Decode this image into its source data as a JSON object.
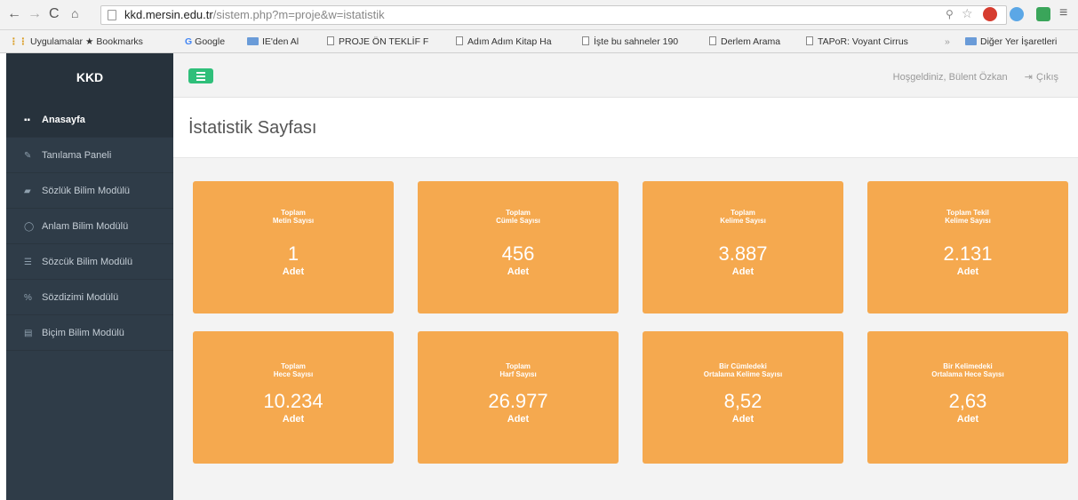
{
  "browser": {
    "url_host": "kkd.mersin.edu.tr",
    "url_path": "/sistem.php?m=proje&w=istatistik",
    "bookmarks": [
      {
        "label": "Uygulamalar",
        "type": "apps"
      },
      {
        "label": "Bookmarks",
        "type": "star"
      },
      {
        "label": "Google",
        "type": "google"
      },
      {
        "label": "IE'den Al",
        "type": "folder"
      },
      {
        "label": "PROJE ÖN TEKLİF F",
        "type": "doc"
      },
      {
        "label": "Adım Adım Kitap Ha",
        "type": "doc"
      },
      {
        "label": "İşte bu sahneler 190",
        "type": "doc"
      },
      {
        "label": "Derlem Arama",
        "type": "doc"
      },
      {
        "label": "TAPoR: Voyant Cirrus",
        "type": "doc"
      },
      {
        "label": "Diğer Yer İşaretleri",
        "type": "folder"
      }
    ]
  },
  "sidebar": {
    "brand": "KKD",
    "items": [
      {
        "label": "Anasayfa",
        "icon": "grid-icon",
        "glyph": "▪▪"
      },
      {
        "label": "Tanılama Paneli",
        "icon": "pencil-icon",
        "glyph": "✎"
      },
      {
        "label": "Sözlük Bilim Modülü",
        "icon": "book-icon",
        "glyph": "▰"
      },
      {
        "label": "Anlam Bilim Modülü",
        "icon": "circle-icon",
        "glyph": "◯"
      },
      {
        "label": "Sözcük Bilim Modülü",
        "icon": "list-icon",
        "glyph": "☰"
      },
      {
        "label": "Sözdizimi Modülü",
        "icon": "percent-icon",
        "glyph": "%"
      },
      {
        "label": "Biçim Bilim Modülü",
        "icon": "file-icon",
        "glyph": "▤"
      }
    ]
  },
  "header": {
    "welcome": "Hoşgeldiniz, Bülent Özkan",
    "logout": "Çıkış"
  },
  "page": {
    "title": "İstatistik Sayfası"
  },
  "stats": [
    {
      "label_1": "Toplam",
      "label_2": "Metin Sayısı",
      "value": "1",
      "unit": "Adet"
    },
    {
      "label_1": "Toplam",
      "label_2": "Cümle Sayısı",
      "value": "456",
      "unit": "Adet"
    },
    {
      "label_1": "Toplam",
      "label_2": "Kelime Sayısı",
      "value": "3.887",
      "unit": "Adet"
    },
    {
      "label_1": "Toplam Tekil",
      "label_2": "Kelime Sayısı",
      "value": "2.131",
      "unit": "Adet"
    },
    {
      "label_1": "Toplam",
      "label_2": "Hece Sayısı",
      "value": "10.234",
      "unit": "Adet"
    },
    {
      "label_1": "Toplam",
      "label_2": "Harf Sayısı",
      "value": "26.977",
      "unit": "Adet"
    },
    {
      "label_1": "Bir Cümledeki",
      "label_2": "Ortalama Kelime Sayısı",
      "value": "8,52",
      "unit": "Adet"
    },
    {
      "label_1": "Bir Kelimedeki",
      "label_2": "Ortalama Hece Sayısı",
      "value": "2,63",
      "unit": "Adet"
    }
  ],
  "colors": {
    "card": "#f5a94f",
    "sidebar": "#2f3c48",
    "menu_button": "#2fbf7a"
  }
}
